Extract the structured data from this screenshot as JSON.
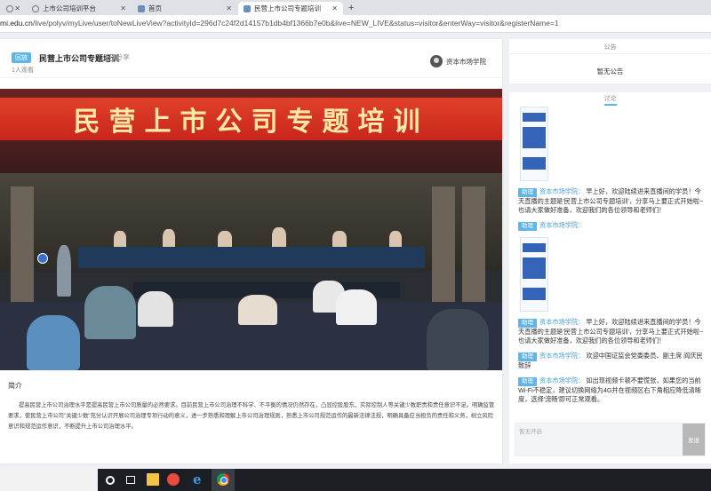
{
  "browser": {
    "tabs": [
      {
        "label": "",
        "icon": "globe-icon"
      },
      {
        "label": "上市公司培训平台",
        "icon": "globe-icon"
      },
      {
        "label": "首页",
        "icon": "document-icon"
      },
      {
        "label": "民营上市公司专题培训",
        "icon": "document-icon"
      }
    ],
    "new_tab": "+",
    "url_host": "mi.edu.cn",
    "url_path": "/live/polyv/myLive/user/toNewLiveView?activityId=296d7c24f2d14157b1db4bf1366b7e0b&live=NEW_LIVE&status=visitor&enterWay=visitor&registerName=1"
  },
  "stream": {
    "badge": "回放",
    "title": "民营上市公司专题培训",
    "share_label": "分享",
    "viewers": "1人观看",
    "host_name": "资本市场学院",
    "banner_text": "民营上市公司专题培训"
  },
  "intro": {
    "heading": "简介",
    "body": "提高民营上市公司治理水平是提高民营上市公司质量的必然要求。目前民营上市公司治理不科学、不平衡的情况仍然存在，凸显控股股东、实际控制人等关键少数职责和责任意识不足。明确监管要求，使民营上市公司\"关键少数\"充分认识开展公司治理专项行动的意义，进一步熟悉和理解上市公司治理规则，熟悉上市公司规范运作的最新法律法规，明确具备应当担负的责任和义务，树立风险意识和规范运作意识，不断提升上市公司治理水平。"
  },
  "notice": {
    "heading": "公告",
    "empty": "暂无公告"
  },
  "chat": {
    "tab": "讨论",
    "assistant_tag": "助理",
    "messages": [
      {
        "type": "image"
      },
      {
        "type": "text",
        "name": "资本市场学院：",
        "text": "早上好，欢迎陆续进来直播间的学员！今天直播的主题是'民营上市公司专题培训'，分享马上要正式开始啦~也请大家做好准备，欢迎我们的各位领导和老师们！"
      },
      {
        "type": "text",
        "name": "资本市场学院：",
        "text": ""
      },
      {
        "type": "image"
      },
      {
        "type": "text",
        "name": "资本市场学院：",
        "text": "早上好，欢迎陆续进来直播间的学员！今天直播的主题是'民营上市公司专题培训'，分享马上要正式开始啦~也请大家做好准备，欢迎我们的各位领导和老师们！"
      },
      {
        "type": "text",
        "name": "资本市场学院：",
        "text": "欢迎中国证监会党委委员、副主席 阎庆民致辞"
      },
      {
        "type": "text",
        "name": "资本市场学院：",
        "text": "如出现视频卡顿不要慌张，如果您的当前Wi-Fi不稳定，建议切换网络为4G并在视频区右下角相应降低清晰度，选择'流畅'即可正常观看。"
      }
    ],
    "composer_placeholder": "暂无开启",
    "send_label": "发送"
  },
  "colors": {
    "accent": "#5fb5e8",
    "banner_red": "#d2301f",
    "banner_text": "#ffe9a8"
  }
}
